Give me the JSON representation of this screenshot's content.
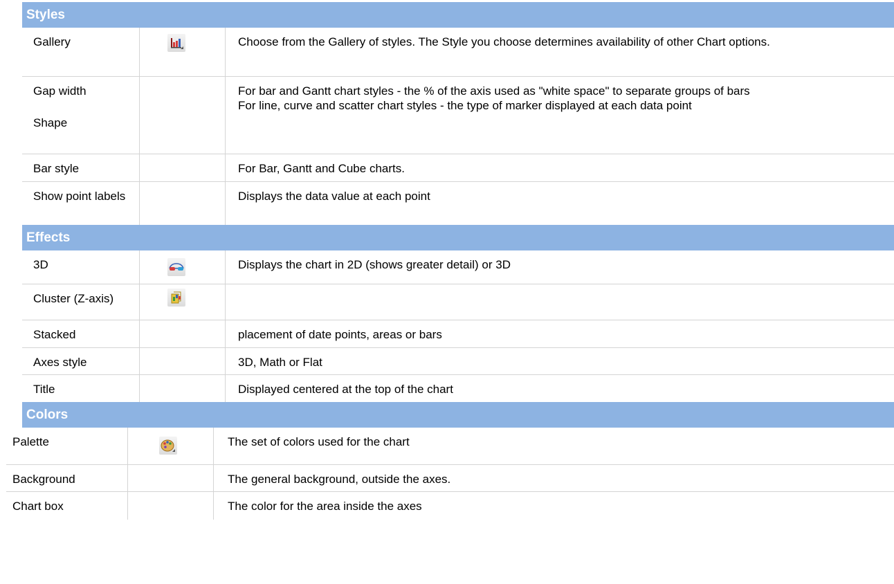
{
  "sections": {
    "styles": {
      "header": "Styles",
      "rows": [
        {
          "name": "Gallery",
          "icon": "chart-gallery-icon",
          "desc": "Choose from the Gallery of styles. The Style you choose determines availability of other Chart options."
        },
        {
          "name": "Gap width",
          "desc": "For bar and Gantt chart styles - the % of the axis used as \"white space\" to separate groups of bars"
        },
        {
          "name": "Shape",
          "desc": "For line, curve and scatter chart styles - the type of marker displayed at each data point"
        },
        {
          "name": "Bar style",
          "desc": "For Bar, Gantt and Cube charts."
        },
        {
          "name": "Show point labels",
          "desc": "Displays the data value at each point"
        }
      ]
    },
    "effects": {
      "header": "Effects",
      "rows": [
        {
          "name": "3D",
          "icon": "3d-glasses-icon",
          "desc": "Displays the chart in 2D (shows greater detail) or 3D"
        },
        {
          "name": "Cluster (Z-axis)",
          "icon": "cluster-icon",
          "desc": ""
        },
        {
          "name": "Stacked",
          "desc": "placement of date points, areas or bars"
        },
        {
          "name": "Axes style",
          "desc": "3D, Math or Flat"
        },
        {
          "name": "Title",
          "desc": "Displayed centered at the top of the chart"
        }
      ]
    },
    "colors": {
      "header": "Colors",
      "rows": [
        {
          "name": "Palette",
          "icon": "palette-icon",
          "desc": "The set of colors used for the chart"
        },
        {
          "name": "Background",
          "desc": "The general background, outside the axes."
        },
        {
          "name": "Chart box",
          "desc": "The color for the area inside the axes"
        }
      ]
    }
  },
  "colors": {
    "header_bg": "#8db3e2",
    "header_text": "#ffffff",
    "grid": "#d4d4d4"
  }
}
